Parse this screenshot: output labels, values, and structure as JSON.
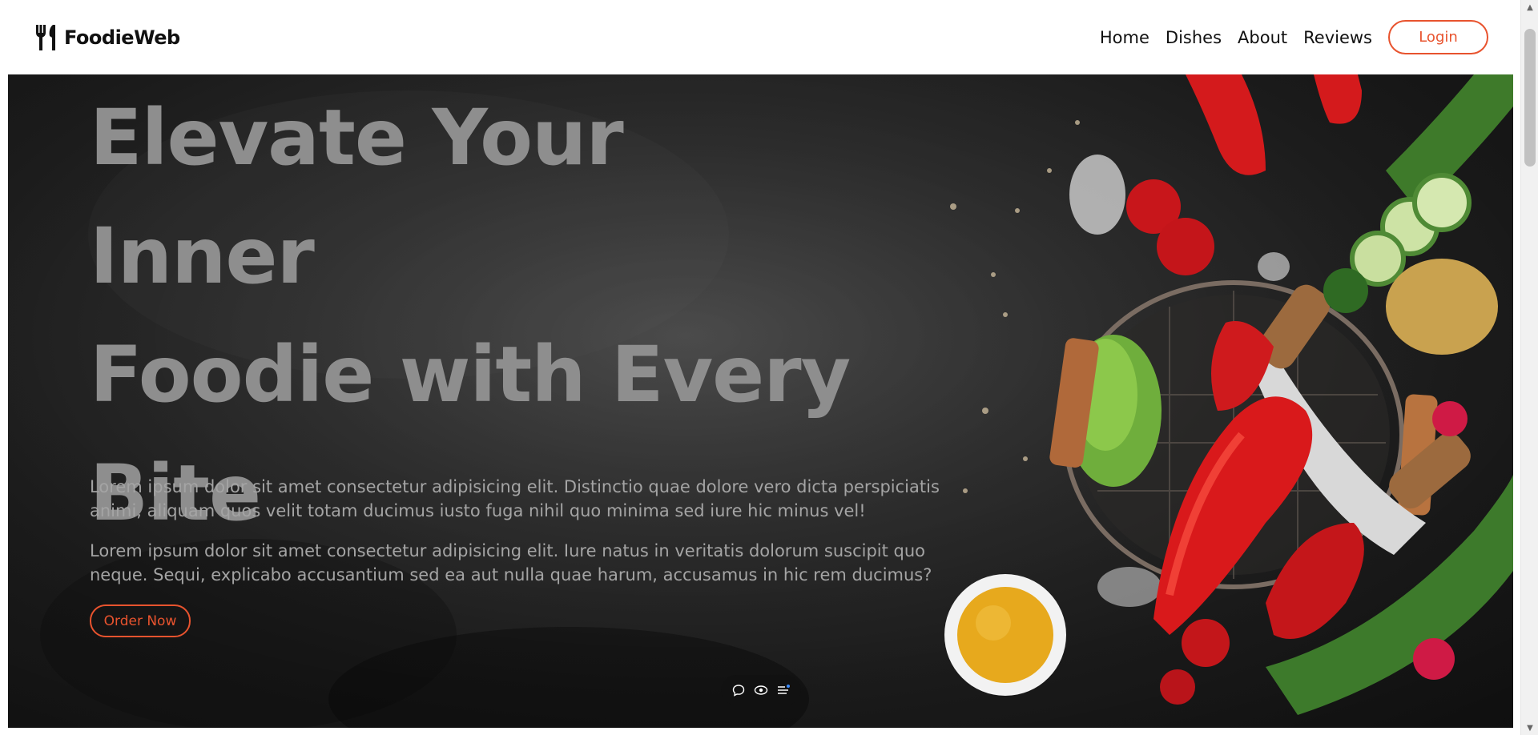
{
  "brand": {
    "name": "FoodieWeb",
    "icon": "fork-knife-icon"
  },
  "nav": {
    "links": [
      "Home",
      "Dishes",
      "About",
      "Reviews"
    ],
    "login_label": "Login"
  },
  "hero": {
    "title_line1": "Elevate Your Inner",
    "title_line2": "Foodie with Every",
    "title_line3": "Bite",
    "paragraph1": "Lorem ipsum dolor sit amet consectetur adipisicing elit. Distinctio quae dolore vero dicta perspiciatis animi, aliquam quos velit totam ducimus iusto fuga nihil quo minima sed iure hic minus vel!",
    "paragraph2": "Lorem ipsum dolor sit amet consectetur adipisicing elit. Iure natus in veritatis dolorum suscipit quo neque. Sequi, explicabo accusantium sed ea aut nulla quae harum, accusamus in hic rem ducimus?",
    "order_label": "Order Now",
    "image": "vegetables-on-dark-table"
  },
  "toolbar": {
    "icons": [
      "chat-icon",
      "eye-icon",
      "list-icon"
    ]
  },
  "colors": {
    "accent": "#e8532e",
    "title": "#8e8e8e",
    "text": "#a4a4a4",
    "background": "#2b2b2b"
  }
}
